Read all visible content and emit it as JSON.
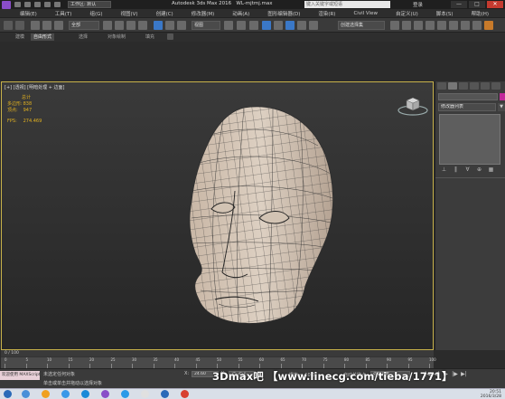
{
  "titlebar": {
    "workspace": "工作区: 默认",
    "app_title": "Autodesk 3ds Max 2016",
    "file_name": "WL-mjtmj.max",
    "search_placeholder": "键入关键字或短语",
    "sign_in": "登录",
    "minimize": "—",
    "maximize": "□",
    "close": "✕"
  },
  "menu": {
    "items": [
      "编辑(E)",
      "工具(T)",
      "组(G)",
      "视图(V)",
      "创建(C)",
      "修改器(M)",
      "动画(A)",
      "图形编辑器(D)",
      "渲染(R)",
      "Civil View",
      "自定义(U)",
      "脚本(S)",
      "帮助(H)"
    ]
  },
  "toolbar": {
    "selection_filter": "全部",
    "ref_coord": "视图",
    "named_selection": "创建选择集"
  },
  "ribbon": {
    "tabs": [
      "建模",
      "自由形式",
      "选择",
      "对象绘制",
      "填充"
    ]
  },
  "viewport": {
    "label": "[+] [透视] [明暗处理 + 边面]",
    "stats": {
      "total_label": "总计",
      "poly_label": "多边形:",
      "poly_value": "838",
      "vert_label": "顶点:",
      "vert_value": "947",
      "fps_label": "FPS:",
      "fps_value": "274.469"
    },
    "object": "head-mesh"
  },
  "command_panel": {
    "modifier_list": "修改器列表",
    "dropdown_arrow": "▼",
    "stack_buttons": [
      "⊥",
      "‖",
      "∀",
      "⊕",
      "▦"
    ]
  },
  "timeline": {
    "frame_display": "0 / 100",
    "ticks": [
      "0",
      "5",
      "10",
      "15",
      "20",
      "25",
      "30",
      "35",
      "40",
      "45",
      "50",
      "55",
      "60",
      "65",
      "70",
      "75",
      "80",
      "85",
      "90",
      "95",
      "100"
    ]
  },
  "status": {
    "welcome": "欢迎使用 MAXScript",
    "selection_msg": "未选定任何对象",
    "prompt_msg": "单击或单击并拖动以选择对象",
    "x_label": "X:",
    "x_value": "24.60",
    "y_label": "Y:",
    "y_value": "25.353",
    "grid_label": "栅格 = 10.0",
    "autokey_label": "自动关键点",
    "selected_field": "选定对象",
    "add_time_tag": "添加时间标记",
    "set_key_label": "设置关键点",
    "key_filter": "关键点过滤器...",
    "play_controls": [
      "|◀",
      "◀|",
      "▶",
      "|▶",
      "▶|"
    ]
  },
  "watermark": "3Dmax吧 【www.linecg.com/tieba/1771】",
  "taskbar": {
    "clock_time": "20:51",
    "clock_date": "2016/3/28"
  },
  "colors": {
    "viewport_border": "#c8b24a",
    "stats_text": "#e0b020",
    "mesh_fill": "#d6c6b6",
    "mesh_wire": "#3a3a3a",
    "accent_magenta": "#c2289a"
  }
}
